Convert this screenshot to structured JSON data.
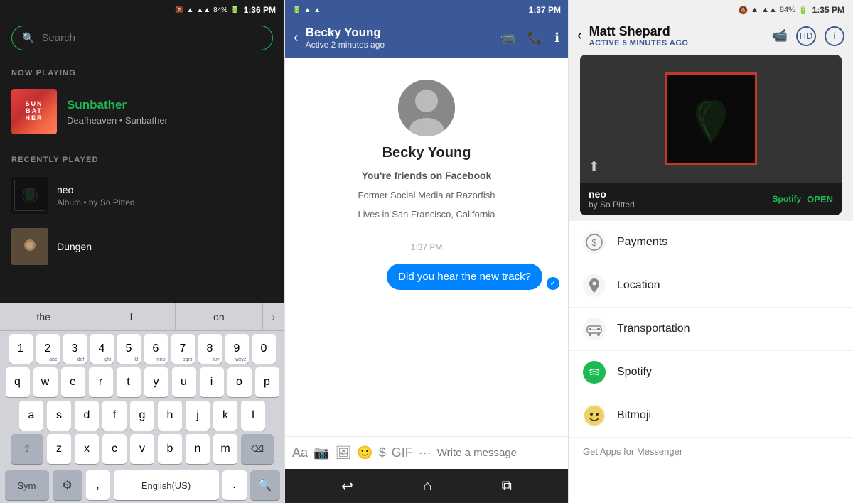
{
  "spotify": {
    "status_time": "1:36 PM",
    "status_battery": "84%",
    "search_placeholder": "Search",
    "section_now_playing": "NOW PLAYING",
    "album_sunbather": {
      "title": "Sunbather",
      "subtitle": "Deafheaven • Sunbather",
      "art_text": "SUN\nBAT\nHER"
    },
    "section_recently_played": "RECENTLY PLAYED",
    "recently_played": [
      {
        "title": "neo",
        "subtitle": "Album • by So Pitted",
        "art_type": "neo"
      },
      {
        "title": "Dungen",
        "subtitle": "",
        "art_type": "dungen"
      }
    ],
    "word_suggestions": [
      "the",
      "l",
      "on"
    ],
    "keys_numbers": [
      "1",
      "2",
      "3",
      "4",
      "5",
      "6",
      "7",
      "8",
      "9",
      "0"
    ],
    "keys_row1": [
      "q",
      "w",
      "e",
      "r",
      "t",
      "y",
      "u",
      "i",
      "o",
      "p"
    ],
    "keys_row2": [
      "a",
      "s",
      "d",
      "f",
      "g",
      "h",
      "j",
      "k",
      "l"
    ],
    "keys_row3": [
      "z",
      "x",
      "c",
      "v",
      "b",
      "n",
      "m"
    ],
    "key_sym": "Sym",
    "key_lang": "English(US)",
    "key_search_icon": "🔍"
  },
  "messenger": {
    "status_time": "1:37 PM",
    "contact_name": "Becky Young",
    "contact_status": "Active 2 minutes ago",
    "contact_friends": "You're friends on Facebook",
    "contact_job": "Former Social Media at Razorfish",
    "contact_location": "Lives in San Francisco, California",
    "timestamp": "1:37 PM",
    "message": "Did you hear the new track?",
    "compose_placeholder": "Write a message",
    "back_label": "‹",
    "nav_back": "↩",
    "nav_home": "⌂",
    "nav_square": "⧉"
  },
  "detail": {
    "status_time": "1:35 PM",
    "status_battery": "84%",
    "contact_name": "Matt Shepard",
    "contact_status": "ACTIVE 5 MINUTES AGO",
    "spotify_track": "neo",
    "spotify_artist": "by So Pitted",
    "spotify_logo": "Spotify",
    "open_label": "OPEN",
    "menu_items": [
      {
        "icon": "$",
        "icon_type": "dollar",
        "label": "Payments"
      },
      {
        "icon": "📍",
        "icon_type": "location",
        "label": "Location"
      },
      {
        "icon": "🚗",
        "icon_type": "transport",
        "label": "Transportation"
      },
      {
        "icon": "♪",
        "icon_type": "spotify",
        "label": "Spotify"
      },
      {
        "icon": "😊",
        "icon_type": "bitmoji",
        "label": "Bitmoji"
      }
    ],
    "get_apps_label": "Get Apps for Messenger"
  }
}
